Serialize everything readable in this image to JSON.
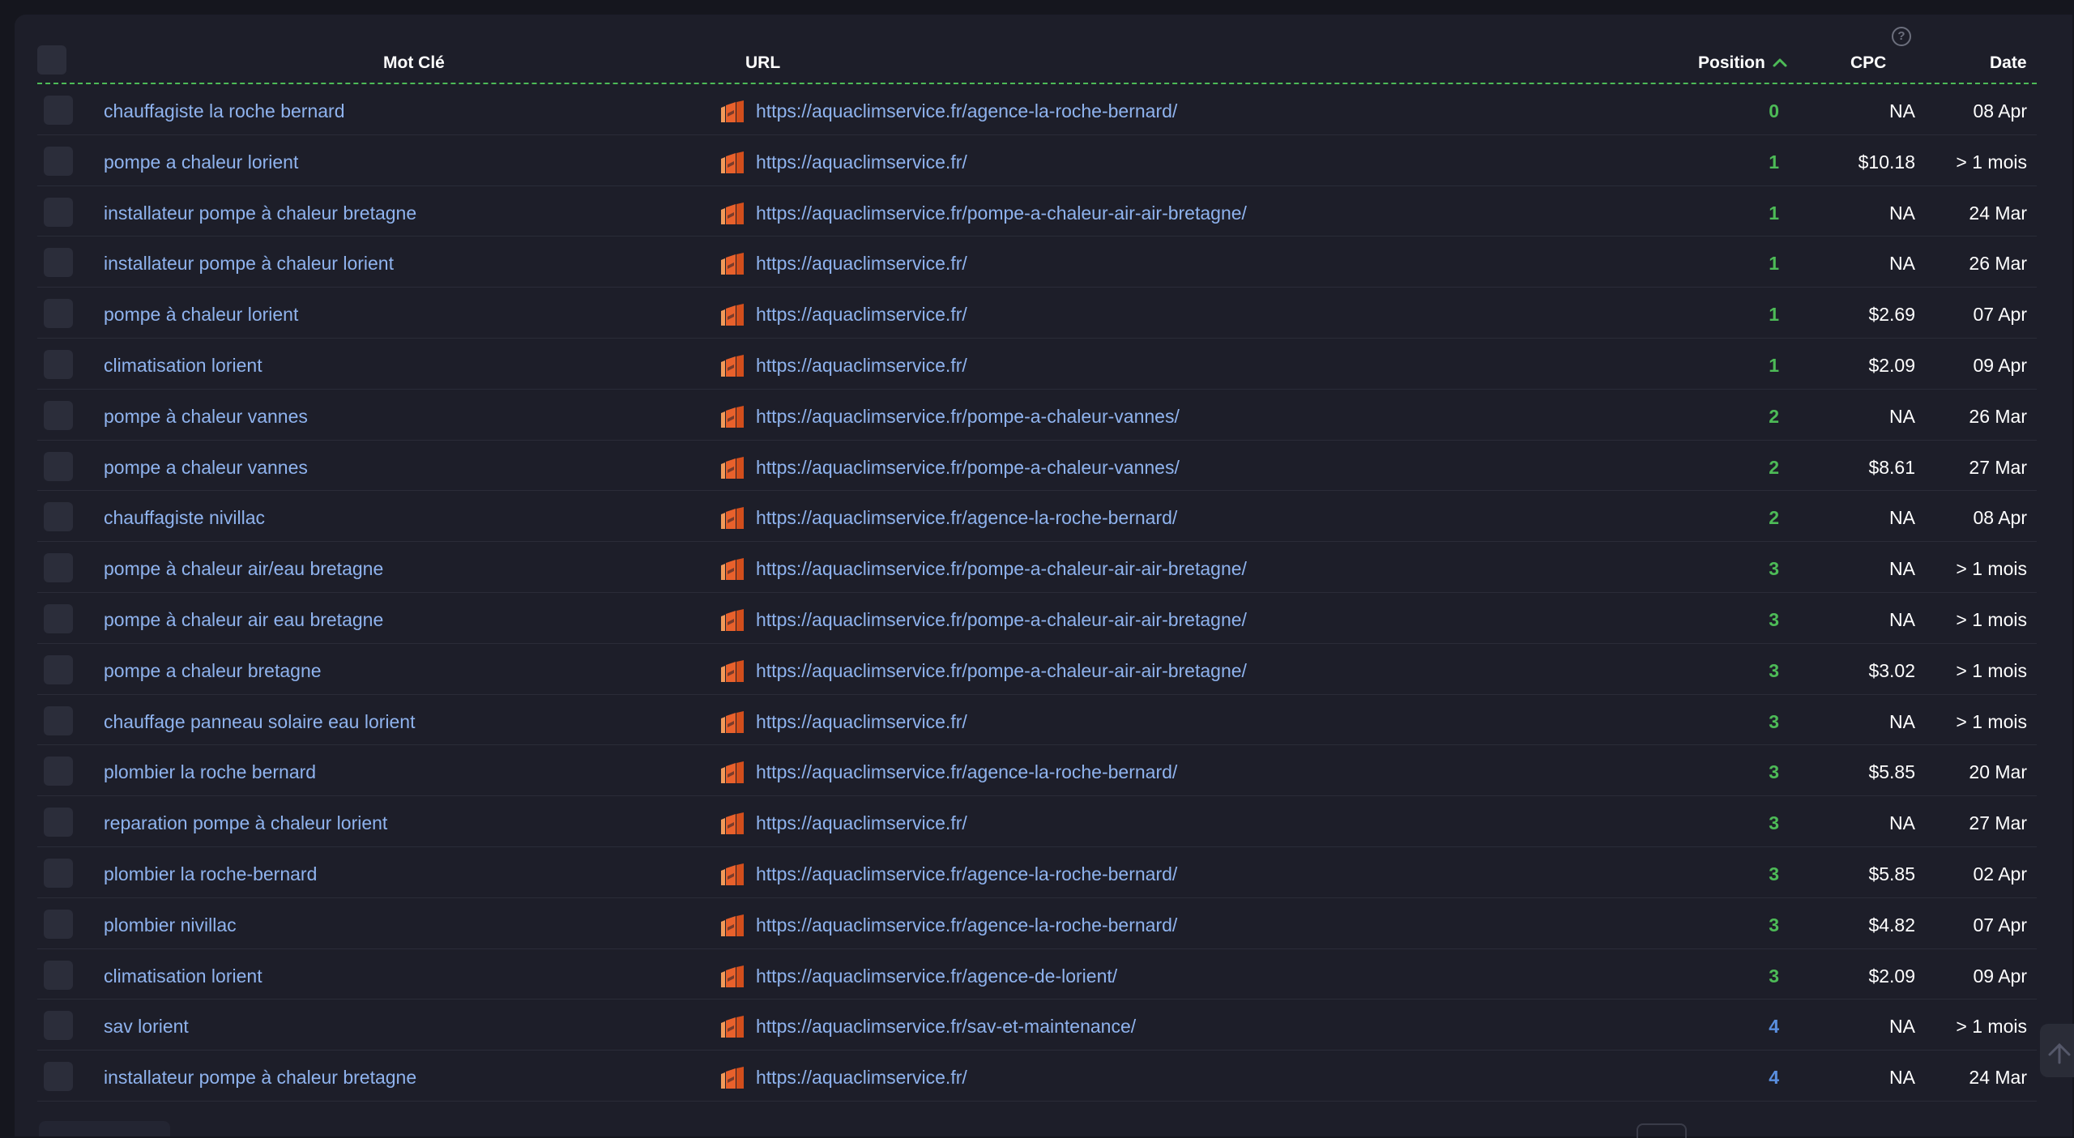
{
  "table": {
    "columns": {
      "keyword": "Mot Clé",
      "url": "URL",
      "position": "Position",
      "cpc": "CPC",
      "date": "Date"
    },
    "help_glyph": "?",
    "rows": [
      {
        "keyword": "chauffagiste la roche bernard",
        "url": "https://aquaclimservice.fr/agence-la-roche-bernard/",
        "position": "0",
        "cpc": "NA",
        "date": "08 Apr"
      },
      {
        "keyword": "pompe a chaleur lorient",
        "url": "https://aquaclimservice.fr/",
        "position": "1",
        "cpc": "$10.18",
        "date": "> 1 mois"
      },
      {
        "keyword": "installateur pompe à chaleur bretagne",
        "url": "https://aquaclimservice.fr/pompe-a-chaleur-air-air-bretagne/",
        "position": "1",
        "cpc": "NA",
        "date": "24 Mar"
      },
      {
        "keyword": "installateur pompe à chaleur lorient",
        "url": "https://aquaclimservice.fr/",
        "position": "1",
        "cpc": "NA",
        "date": "26 Mar"
      },
      {
        "keyword": "pompe à chaleur lorient",
        "url": "https://aquaclimservice.fr/",
        "position": "1",
        "cpc": "$2.69",
        "date": "07 Apr"
      },
      {
        "keyword": "climatisation lorient",
        "url": "https://aquaclimservice.fr/",
        "position": "1",
        "cpc": "$2.09",
        "date": "09 Apr"
      },
      {
        "keyword": "pompe à chaleur vannes",
        "url": "https://aquaclimservice.fr/pompe-a-chaleur-vannes/",
        "position": "2",
        "cpc": "NA",
        "date": "26 Mar"
      },
      {
        "keyword": "pompe a chaleur vannes",
        "url": "https://aquaclimservice.fr/pompe-a-chaleur-vannes/",
        "position": "2",
        "cpc": "$8.61",
        "date": "27 Mar"
      },
      {
        "keyword": "chauffagiste nivillac",
        "url": "https://aquaclimservice.fr/agence-la-roche-bernard/",
        "position": "2",
        "cpc": "NA",
        "date": "08 Apr"
      },
      {
        "keyword": "pompe à chaleur air/eau bretagne",
        "url": "https://aquaclimservice.fr/pompe-a-chaleur-air-air-bretagne/",
        "position": "3",
        "cpc": "NA",
        "date": "> 1 mois"
      },
      {
        "keyword": "pompe à chaleur air eau bretagne",
        "url": "https://aquaclimservice.fr/pompe-a-chaleur-air-air-bretagne/",
        "position": "3",
        "cpc": "NA",
        "date": "> 1 mois"
      },
      {
        "keyword": "pompe a chaleur bretagne",
        "url": "https://aquaclimservice.fr/pompe-a-chaleur-air-air-bretagne/",
        "position": "3",
        "cpc": "$3.02",
        "date": "> 1 mois"
      },
      {
        "keyword": "chauffage panneau solaire eau lorient",
        "url": "https://aquaclimservice.fr/",
        "position": "3",
        "cpc": "NA",
        "date": "> 1 mois"
      },
      {
        "keyword": "plombier la roche bernard",
        "url": "https://aquaclimservice.fr/agence-la-roche-bernard/",
        "position": "3",
        "cpc": "$5.85",
        "date": "20 Mar"
      },
      {
        "keyword": "reparation pompe à chaleur lorient",
        "url": "https://aquaclimservice.fr/",
        "position": "3",
        "cpc": "NA",
        "date": "27 Mar"
      },
      {
        "keyword": "plombier la roche-bernard",
        "url": "https://aquaclimservice.fr/agence-la-roche-bernard/",
        "position": "3",
        "cpc": "$5.85",
        "date": "02 Apr"
      },
      {
        "keyword": "plombier nivillac",
        "url": "https://aquaclimservice.fr/agence-la-roche-bernard/",
        "position": "3",
        "cpc": "$4.82",
        "date": "07 Apr"
      },
      {
        "keyword": "climatisation lorient",
        "url": "https://aquaclimservice.fr/agence-de-lorient/",
        "position": "3",
        "cpc": "$2.09",
        "date": "09 Apr"
      },
      {
        "keyword": "sav lorient",
        "url": "https://aquaclimservice.fr/sav-et-maintenance/",
        "position": "4",
        "cpc": "NA",
        "date": "> 1 mois"
      },
      {
        "keyword": "installateur pompe à chaleur bretagne",
        "url": "https://aquaclimservice.fr/",
        "position": "4",
        "cpc": "NA",
        "date": "24 Mar"
      }
    ]
  },
  "colors": {
    "background": "#15161e",
    "panel": "#1d1e29",
    "link": "#8fb3ee",
    "position_green": "#4dbb57",
    "position_blue": "#5a8fe0",
    "header_divider": "#4dbb57",
    "favicon_orange": "#e8612c"
  },
  "icons": {
    "sort": "chevron-up-icon",
    "help": "question-circle-icon",
    "favicon": "site-favicon-icon",
    "scroll_top": "arrow-up-icon"
  }
}
